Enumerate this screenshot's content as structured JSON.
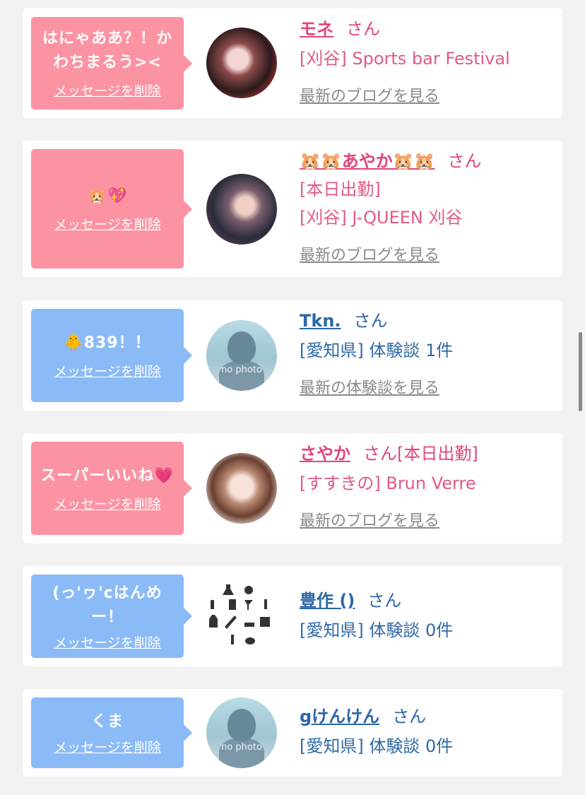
{
  "entries": [
    {
      "message": "はにゃああ？！かわちまるう><",
      "delete_label": "メッセージを削除",
      "name": "モネ",
      "san": "さん",
      "lines": [
        "[刈谷] Sports bar Festival"
      ],
      "link": "最新のブログを見る"
    },
    {
      "message": "🐹💖",
      "delete_label": "メッセージを削除",
      "name": "🐹🐹あやか🐹🐹",
      "san": "さん",
      "lines": [
        "[本日出勤]",
        "[刈谷] J-QUEEN 刈谷"
      ],
      "link": "最新のブログを見る"
    },
    {
      "message": "🐥839！！",
      "delete_label": "メッセージを削除",
      "name": "Tkn.",
      "san": "さん",
      "lines": [
        "[愛知県] 体験談 1件"
      ],
      "link": "最新の体験談を見る",
      "nophoto": "no photo"
    },
    {
      "message": "スーパーいいね💗",
      "delete_label": "メッセージを削除",
      "name": "さやか",
      "san": "さん[本日出勤]",
      "lines": [
        "[すすきの] Brun Verre"
      ],
      "link": "最新のブログを見る"
    },
    {
      "message": "(っ'ヮ'cはんめー！",
      "delete_label": "メッセージを削除",
      "name": "豊作 ()",
      "san": "さん",
      "lines": [
        "[愛知県] 体験談 0件"
      ]
    },
    {
      "message": "くま",
      "delete_label": "メッセージを削除",
      "name": "gけんけん",
      "san": "さん",
      "lines": [
        "[愛知県] 体験談 0件"
      ],
      "nophoto": "no photo"
    }
  ]
}
